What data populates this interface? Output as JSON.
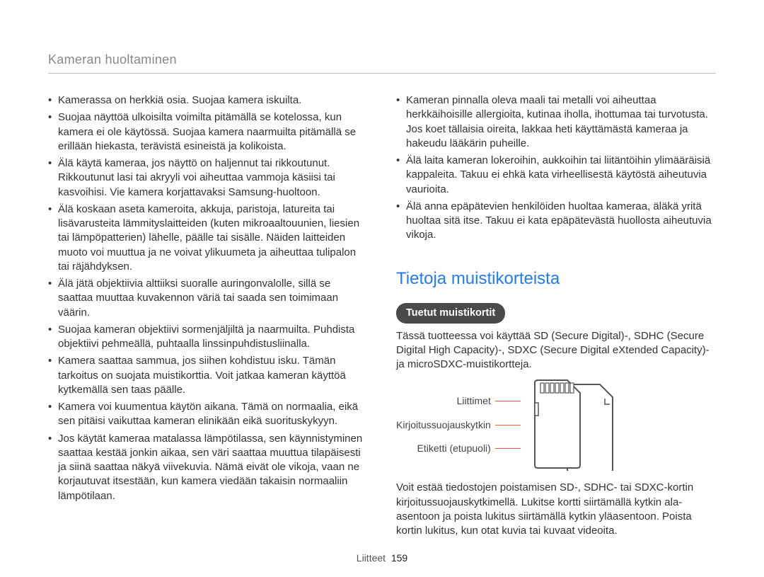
{
  "breadcrumb": "Kameran huoltaminen",
  "left_bullets": [
    "Kamerassa on herkkiä osia. Suojaa kamera iskuilta.",
    "Suojaa näyttöä ulkoisilta voimilta pitämällä se kotelossa, kun kamera ei ole käytössä. Suojaa kamera naarmuilta pitämällä se erillään hiekasta, terävistä esineistä ja kolikoista.",
    "Älä käytä kameraa, jos näyttö on haljennut tai rikkoutunut. Rikkoutunut lasi tai akryyli voi aiheuttaa vammoja käsiisi tai kasvoihisi. Vie kamera korjattavaksi Samsung-huoltoon.",
    "Älä koskaan aseta kameroita, akkuja, paristoja, latureita tai lisävarusteita lämmityslaitteiden (kuten mikroaaltouunien, liesien tai lämpöpatterien) lähelle, päälle tai sisälle. Näiden laitteiden muoto voi muuttua ja ne voivat ylikuumeta ja aiheuttaa tulipalon tai räjähdyksen.",
    "Älä jätä objektiivia alttiiksi suoralle auringonvalolle, sillä se saattaa muuttaa kuvakennon väriä tai saada sen toimimaan väärin.",
    "Suojaa kameran objektiivi sormenjäljiltä ja naarmuilta. Puhdista objektiivi pehmeällä, puhtaalla linssinpuhdistusliinalla.",
    "Kamera saattaa sammua, jos siihen kohdistuu isku. Tämän tarkoitus on suojata muistikorttia. Voit jatkaa kameran käyttöä kytkemällä sen taas päälle.",
    "Kamera voi kuumentua käytön aikana. Tämä on normaalia, eikä sen pitäisi vaikuttaa kameran elinikään eikä suorituskykyyn.",
    "Jos käytät kameraa matalassa lämpötilassa, sen käynnistyminen saattaa kestää jonkin aikaa, sen väri saattaa muuttua tilapäisesti ja siinä saattaa näkyä viivekuvia. Nämä eivät ole vikoja, vaan ne korjautuvat itsestään, kun kamera viedään takaisin normaaliin lämpötilaan."
  ],
  "right_bullets": [
    "Kameran pinnalla oleva maali tai metalli voi aiheuttaa herkkäihoisille allergioita, kutinaa iholla, ihottumaa tai turvotusta. Jos koet tällaisia oireita, lakkaa heti käyttämästä kameraa ja hakeudu lääkärin puheille.",
    "Älä laita kameran lokeroihin, aukkoihin tai liitäntöihin ylimääräisiä kappaleita. Takuu ei ehkä kata virheellisestä käytöstä aiheutuvia vaurioita.",
    "Älä anna epäpätevien henkilöiden huoltaa kameraa, äläkä yritä huoltaa sitä itse. Takuu ei kata epäpätevästä huollosta aiheutuvia vikoja."
  ],
  "section_title": "Tietoja muistikorteista",
  "pill": "Tuetut muistikortit",
  "para_supported": "Tässä tuotteessa voi käyttää SD (Secure Digital)-, SDHC (Secure Digital High Capacity)-, SDXC (Secure Digital eXtended Capacity)- ja microSDXC-muistikortteja.",
  "sd_labels": {
    "terminal": "Liittimet",
    "wpswitch": "Kirjoitussuojauskytkin",
    "label": "Etiketti (etupuoli)"
  },
  "para_lock": "Voit estää tiedostojen poistamisen SD-, SDHC- tai SDXC-kortin kirjoitussuojauskytkimellä. Lukitse kortti siirtämällä kytkin ala-asentoon ja poista lukitus siirtämällä kytkin yläasentoon. Poista kortin lukitus, kun otat kuvia tai kuvaat videoita.",
  "footer_section": "Liitteet",
  "footer_page": "159"
}
